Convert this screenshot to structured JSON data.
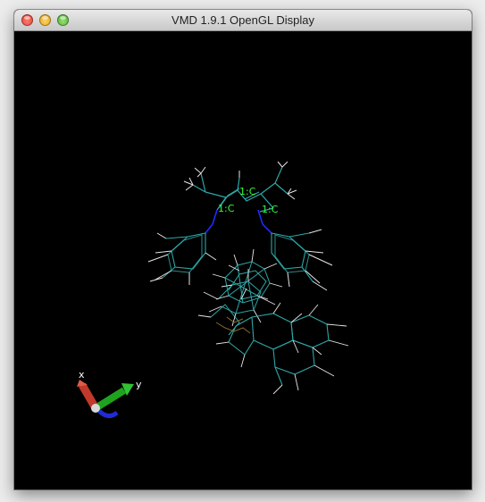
{
  "window": {
    "title": "VMD 1.9.1 OpenGL Display"
  },
  "buttons": {
    "close": "close-button",
    "minimize": "minimize-button",
    "maximize": "zoom-button"
  },
  "atom_labels": [
    "1:C",
    "1:C",
    "1:C"
  ],
  "axes": {
    "x_label": "x",
    "y_label": "y"
  },
  "colors": {
    "background": "#000000",
    "bond_cyan": "#2fa6a6",
    "bond_white": "#e6e6e6",
    "nitrogen": "#1f2bff",
    "label_green": "#33ff33",
    "axis_x": "#c0392b",
    "axis_y": "#1fa31f",
    "axis_z": "#1f2bd6",
    "tail": "#8a6a2a"
  }
}
